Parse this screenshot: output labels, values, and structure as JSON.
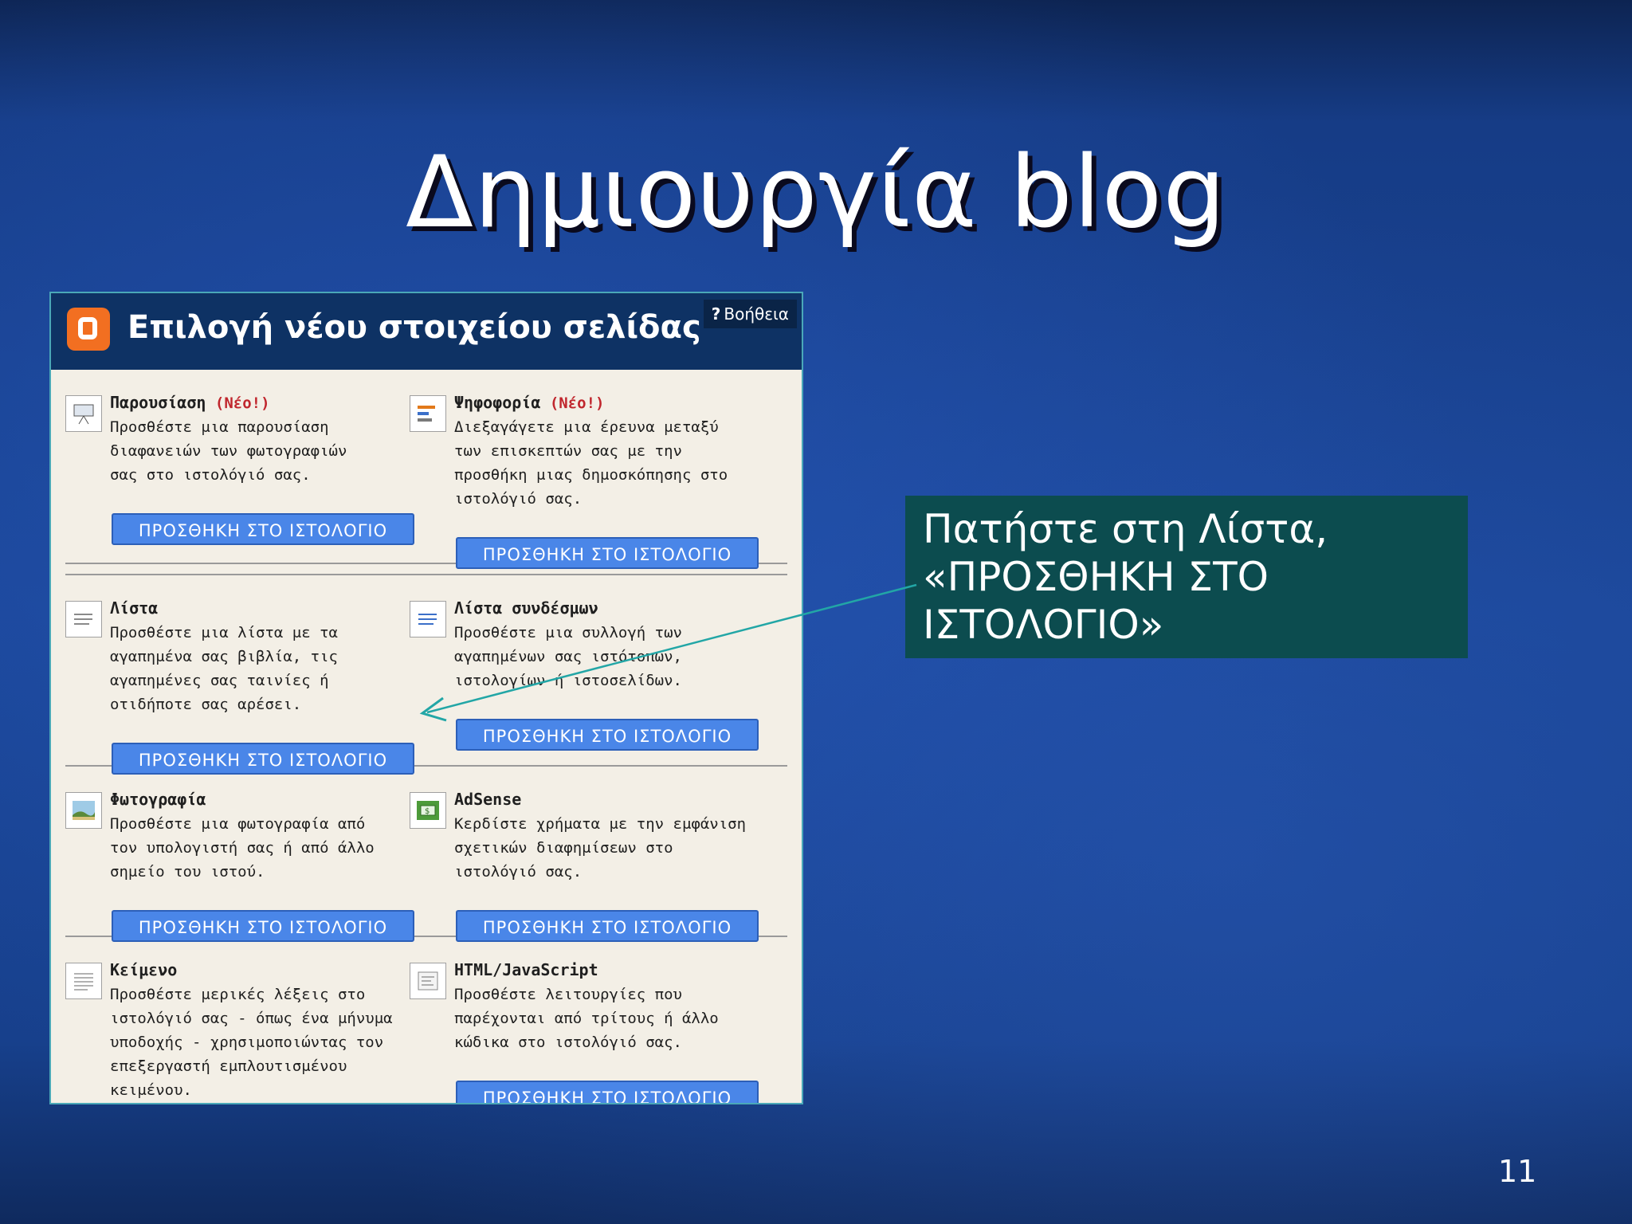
{
  "slide": {
    "title": "Δημιουργία blog",
    "page_number": "11"
  },
  "dialog": {
    "title": "Επιλογή νέου στοιχείου σελίδας",
    "help": "Βοήθεια",
    "help_icon": "?",
    "button_label": "ΠΡΟΣΘΗΚΗ ΣΤΟ ΙΣΤΟΛΟΓΙΟ",
    "items": [
      {
        "name": "Παρουσίαση",
        "badge": "(Νέο!)",
        "icon": "slideshow-icon",
        "desc": [
          "Προσθέστε μια παρουσίαση",
          "διαφανειών των φωτογραφιών",
          "σας στο ιστολόγιό σας."
        ]
      },
      {
        "name": "Ψηφοφορία",
        "badge": "(Νέο!)",
        "icon": "poll-icon",
        "desc": [
          "Διεξαγάγετε μια έρευνα μεταξύ",
          "των επισκεπτών σας με την",
          "προσθήκη μιας δημοσκόπησης στο",
          "ιστολόγιό σας."
        ]
      },
      {
        "name": "Λίστα",
        "badge": "",
        "icon": "list-icon",
        "desc": [
          "Προσθέστε μια λίστα με τα",
          "αγαπημένα σας βιβλία, τις",
          "αγαπημένες σας ταινίες ή",
          "οτιδήποτε σας αρέσει."
        ]
      },
      {
        "name": "Λίστα συνδέσμων",
        "badge": "",
        "icon": "link-list-icon",
        "desc": [
          "Προσθέστε μια συλλογή των",
          "αγαπημένων σας ιστότοπων,",
          "ιστολογίων ή ιστοσελίδων."
        ]
      },
      {
        "name": "Φωτογραφία",
        "badge": "",
        "icon": "photo-icon",
        "desc": [
          "Προσθέστε μια φωτογραφία από",
          "τον υπολογιστή σας ή από άλλο",
          "σημείο του ιστού."
        ]
      },
      {
        "name": "AdSense",
        "badge": "",
        "icon": "adsense-icon",
        "desc": [
          "Κερδίστε χρήματα με την εμφάνιση",
          "σχετικών διαφημίσεων στο",
          "ιστολόγιό σας."
        ]
      },
      {
        "name": "Κείμενο",
        "badge": "",
        "icon": "text-icon",
        "desc": [
          "Προσθέστε μερικές λέξεις στο",
          "ιστολόγιό σας - όπως ένα μήνυμα",
          "υποδοχής - χρησιμοποιώντας τον",
          "επεξεργαστή εμπλουτισμένου",
          "κειμένου."
        ]
      },
      {
        "name": "HTML/JavaScript",
        "badge": "",
        "icon": "html-icon",
        "desc": [
          "Προσθέστε λειτουργίες που",
          "παρέχονται από τρίτους ή άλλο",
          "κώδικα στο ιστολόγιό σας."
        ]
      }
    ]
  },
  "callout": {
    "lines": [
      "Πατήστε στη Λίστα,",
      "«ΠΡΟΣΘΗΚΗ ΣΤΟ",
      "ΙΣΤΟΛΟΓΙΟ»"
    ]
  },
  "colors": {
    "background": "#1a4596",
    "callout_bg": "#0c4c4f",
    "dialog_header": "#0e3264",
    "button": "#4a86e8",
    "badge": "#c0262d",
    "arrow": "#22a6a6"
  }
}
